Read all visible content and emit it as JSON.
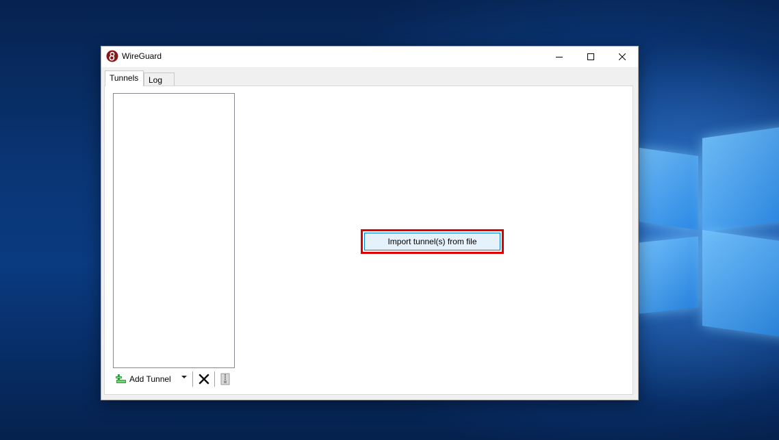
{
  "window": {
    "title": "WireGuard",
    "icon": "wireguard-logo-icon",
    "controls": {
      "minimize_icon": "minimize-icon",
      "maximize_icon": "maximize-icon",
      "close_icon": "close-icon"
    }
  },
  "tabs": [
    {
      "label": "Tunnels",
      "active": true
    },
    {
      "label": "Log",
      "active": false
    }
  ],
  "tunnels": {
    "items": [],
    "toolbar": {
      "add_label": "Add Tunnel",
      "add_icon": "add-tunnel-icon",
      "dropdown_icon": "chevron-down-icon",
      "delete_icon": "delete-x-icon",
      "export_icon": "export-zip-icon"
    }
  },
  "main": {
    "import_button_label": "Import tunnel(s) from file"
  },
  "colors": {
    "highlight": "#e00000",
    "button_bg": "#e5f1fb",
    "button_border": "#0078d7",
    "logo_red": "#88171a"
  }
}
